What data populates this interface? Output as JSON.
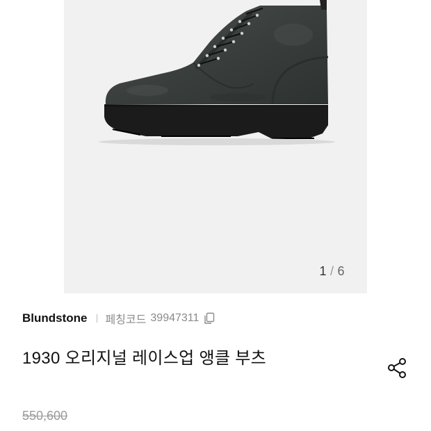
{
  "gallery": {
    "image_alt": "boot-image",
    "current": "1",
    "separator": "/",
    "total": "6"
  },
  "product": {
    "brand": "Blundstone",
    "code_label": "페칭코드",
    "code_value": "39947311",
    "title": "1930 오리지널 레이스업 앵클 부츠",
    "original_price": "550,600"
  },
  "icons": {
    "copy": "copy-icon",
    "share": "share-icon"
  },
  "colors": {
    "gallery_bg": "#f1f1f1",
    "boot_leather": "#3b403e",
    "boot_sole": "#1b1b1b"
  }
}
